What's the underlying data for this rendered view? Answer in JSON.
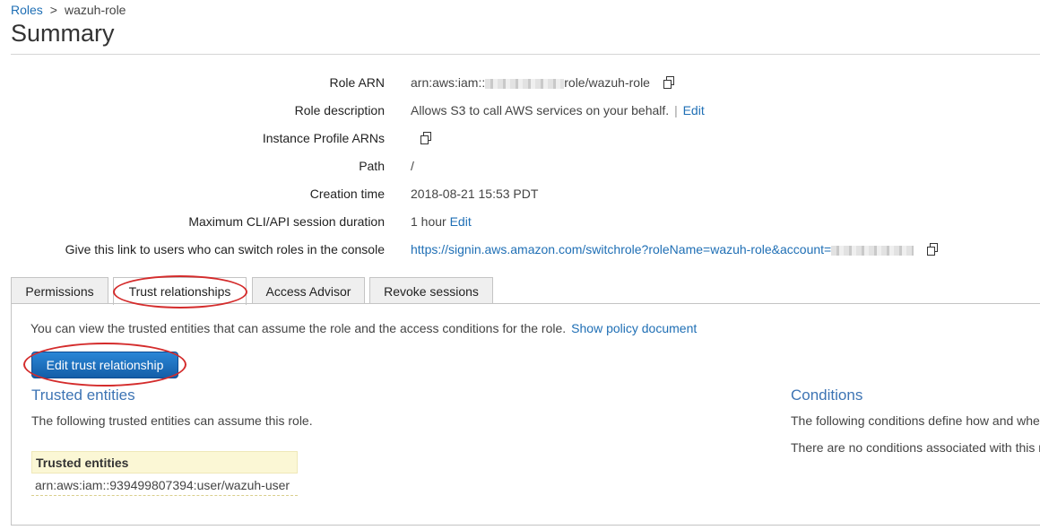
{
  "breadcrumb": {
    "root": "Roles",
    "separator": ">",
    "current": "wazuh-role"
  },
  "page_title": "Summary",
  "summary": {
    "role_arn": {
      "label": "Role ARN",
      "prefix": "arn:aws:iam::",
      "suffix": "role/wazuh-role"
    },
    "role_description": {
      "label": "Role description",
      "value": "Allows S3 to call AWS services on your behalf.",
      "separator": "|",
      "edit": "Edit"
    },
    "instance_profile": {
      "label": "Instance Profile ARNs"
    },
    "path": {
      "label": "Path",
      "value": "/"
    },
    "creation_time": {
      "label": "Creation time",
      "value": "2018-08-21 15:53 PDT"
    },
    "max_session": {
      "label": "Maximum CLI/API session duration",
      "value": "1 hour",
      "edit": "Edit"
    },
    "switch_link": {
      "label": "Give this link to users who can switch roles in the console",
      "url": "https://signin.aws.amazon.com/switchrole?roleName=wazuh-role&account="
    }
  },
  "tabs": [
    {
      "label": "Permissions",
      "active": false
    },
    {
      "label": "Trust relationships",
      "active": true
    },
    {
      "label": "Access Advisor",
      "active": false
    },
    {
      "label": "Revoke sessions",
      "active": false
    }
  ],
  "panel": {
    "intro": "You can view the trusted entities that can assume the role and the access conditions for the role.",
    "show_policy": "Show policy document",
    "edit_button": "Edit trust relationship",
    "trusted": {
      "title": "Trusted entities",
      "description": "The following trusted entities can assume this role.",
      "table_header": "Trusted entities",
      "rows": [
        "arn:aws:iam::939499807394:user/wazuh-user"
      ]
    },
    "conditions": {
      "title": "Conditions",
      "description": "The following conditions define how and wher",
      "empty": "There are no conditions associated with this r"
    }
  },
  "colors": {
    "link": "#1f6fb5",
    "button": "#1a6fc0",
    "callout": "#d42c2c",
    "section_title": "#3d74b4"
  },
  "icons": {
    "copy": "copy-icon"
  }
}
